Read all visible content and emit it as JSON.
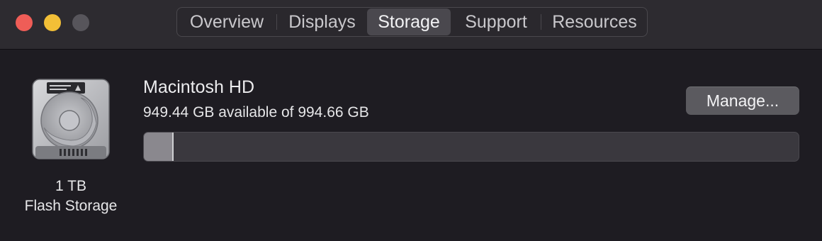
{
  "window": {
    "traffic_lights": {
      "close": "#ef5d57",
      "minimize": "#f2bf37",
      "zoom": "#57555b"
    }
  },
  "tabs": [
    {
      "label": "Overview",
      "selected": false
    },
    {
      "label": "Displays",
      "selected": false
    },
    {
      "label": "Storage",
      "selected": true
    },
    {
      "label": "Support",
      "selected": false
    },
    {
      "label": "Resources",
      "selected": false
    }
  ],
  "storage": {
    "drive_icon": "hard-drive-icon",
    "capacity": "1 TB",
    "type": "Flash Storage",
    "volume_name": "Macintosh HD",
    "availability": "949.44 GB available of 994.66 GB",
    "used_fraction": 0.0455,
    "manage_label": "Manage..."
  }
}
